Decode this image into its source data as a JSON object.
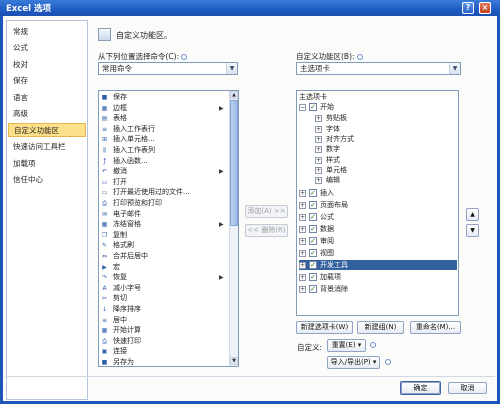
{
  "window": {
    "title": "Excel 选项",
    "help_glyph": "?",
    "close_glyph": "×"
  },
  "sidebar": {
    "items": [
      {
        "label": "常规"
      },
      {
        "label": "公式"
      },
      {
        "label": "校对"
      },
      {
        "label": "保存"
      },
      {
        "label": "语言"
      },
      {
        "label": "高级"
      },
      {
        "label": "自定义功能区",
        "selected": true
      },
      {
        "label": "快速访问工具栏"
      },
      {
        "label": "加载项"
      },
      {
        "label": "信任中心"
      }
    ]
  },
  "main": {
    "title": "自定义功能区。",
    "icon": "customize-ribbon-icon",
    "choose_commands": {
      "label": "从下列位置选择命令(C):",
      "value": "常用命令"
    },
    "customize_ribbon": {
      "label": "自定义功能区(B):",
      "value": "主选项卡"
    },
    "commands": [
      {
        "label": "保存",
        "icon": "save-icon",
        "submenu": false
      },
      {
        "label": "边框",
        "icon": "border-icon",
        "submenu": true
      },
      {
        "label": "表格",
        "icon": "table-icon",
        "submenu": false
      },
      {
        "label": "插入工作表行",
        "icon": "insert-row-icon",
        "submenu": false
      },
      {
        "label": "插入单元格...",
        "icon": "insert-cells-icon",
        "submenu": false
      },
      {
        "label": "插入工作表列",
        "icon": "insert-column-icon",
        "submenu": false
      },
      {
        "label": "插入函数...",
        "icon": "function-icon",
        "submenu": false
      },
      {
        "label": "撤消",
        "icon": "undo-icon",
        "submenu": true
      },
      {
        "label": "打开",
        "icon": "open-icon",
        "submenu": false
      },
      {
        "label": "打开最近使用过的文件...",
        "icon": "recent-files-icon",
        "submenu": false
      },
      {
        "label": "打印预览和打印",
        "icon": "print-preview-icon",
        "submenu": false
      },
      {
        "label": "电子邮件",
        "icon": "email-icon",
        "submenu": false
      },
      {
        "label": "冻结窗格",
        "icon": "freeze-panes-icon",
        "submenu": true
      },
      {
        "label": "复制",
        "icon": "copy-icon",
        "submenu": false
      },
      {
        "label": "格式刷",
        "icon": "format-painter-icon",
        "submenu": false
      },
      {
        "label": "合并后居中",
        "icon": "merge-center-icon",
        "submenu": false
      },
      {
        "label": "宏",
        "icon": "macro-icon",
        "submenu": false
      },
      {
        "label": "恢复",
        "icon": "redo-icon",
        "submenu": true
      },
      {
        "label": "减小字号",
        "icon": "decrease-font-icon",
        "submenu": false
      },
      {
        "label": "剪切",
        "icon": "cut-icon",
        "submenu": false
      },
      {
        "label": "降序排序",
        "icon": "sort-descending-icon",
        "submenu": false
      },
      {
        "label": "居中",
        "icon": "center-icon",
        "submenu": false
      },
      {
        "label": "开始计算",
        "icon": "calculate-icon",
        "submenu": false
      },
      {
        "label": "快速打印",
        "icon": "quick-print-icon",
        "submenu": false
      },
      {
        "label": "连接",
        "icon": "connections-icon",
        "submenu": false
      },
      {
        "label": "另存为",
        "icon": "save-as-icon",
        "submenu": false
      }
    ],
    "add_button": "添加(A) >>",
    "remove_button": "<< 删除(R)",
    "tree": {
      "header": "主选项卡",
      "items": [
        {
          "label": "开始",
          "level": 0,
          "expanded": true,
          "checked": true
        },
        {
          "label": "剪贴板",
          "level": 1,
          "expanded": false,
          "checked": false
        },
        {
          "label": "字体",
          "level": 1,
          "expanded": false,
          "checked": false
        },
        {
          "label": "对齐方式",
          "level": 1,
          "expanded": false,
          "checked": false
        },
        {
          "label": "数字",
          "level": 1,
          "expanded": false,
          "checked": false
        },
        {
          "label": "样式",
          "level": 1,
          "expanded": false,
          "checked": false
        },
        {
          "label": "单元格",
          "level": 1,
          "expanded": false,
          "checked": false
        },
        {
          "label": "编辑",
          "level": 1,
          "expanded": false,
          "checked": false
        },
        {
          "label": "插入",
          "level": 0,
          "expanded": false,
          "checked": true
        },
        {
          "label": "页面布局",
          "level": 0,
          "expanded": false,
          "checked": true
        },
        {
          "label": "公式",
          "level": 0,
          "expanded": false,
          "checked": true
        },
        {
          "label": "数据",
          "level": 0,
          "expanded": false,
          "checked": true
        },
        {
          "label": "审阅",
          "level": 0,
          "expanded": false,
          "checked": true
        },
        {
          "label": "视图",
          "level": 0,
          "expanded": false,
          "checked": true
        },
        {
          "label": "开发工具",
          "level": 0,
          "expanded": false,
          "checked": true,
          "selected": true
        },
        {
          "label": "加载项",
          "level": 0,
          "expanded": false,
          "checked": true
        },
        {
          "label": "背景消除",
          "level": 0,
          "expanded": false,
          "checked": true
        }
      ]
    },
    "move_up": "▲",
    "move_down": "▼",
    "new_tab_button": "新建选项卡(W)",
    "new_group_button": "新建组(N)",
    "rename_button": "重命名(M)...",
    "customizations_label": "自定义:",
    "reset_button": "重置(E) ▾",
    "import_export_button": "导入/导出(P) ▾"
  },
  "footer": {
    "ok": "确定",
    "cancel": "取消"
  }
}
